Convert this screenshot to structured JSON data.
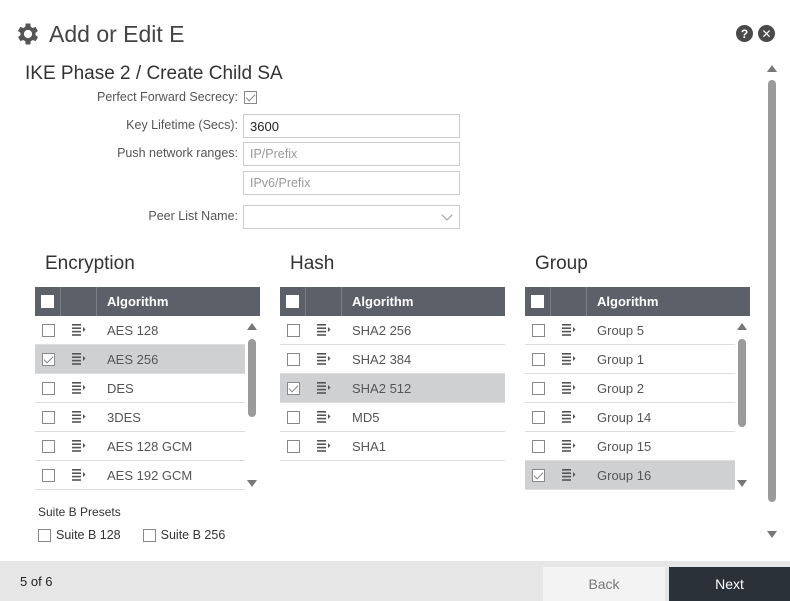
{
  "header": {
    "title": "Add or Edit E"
  },
  "section": {
    "title": "IKE Phase 2 / Create Child SA"
  },
  "form": {
    "pfs_label": "Perfect Forward Secrecy:",
    "pfs_checked": true,
    "lifetime_label": "Key Lifetime (Secs):",
    "lifetime_value": "3600",
    "push_label": "Push network ranges:",
    "ipv4_placeholder": "IP/Prefix",
    "ipv6_placeholder": "IPv6/Prefix",
    "peer_label": "Peer List Name:",
    "peer_value": ""
  },
  "tables": {
    "column_header": "Algorithm",
    "encryption": {
      "title": "Encryption",
      "rows": [
        {
          "label": "AES 128",
          "checked": false
        },
        {
          "label": "AES 256",
          "checked": true
        },
        {
          "label": "DES",
          "checked": false
        },
        {
          "label": "3DES",
          "checked": false
        },
        {
          "label": "AES 128 GCM",
          "checked": false
        },
        {
          "label": "AES 192 GCM",
          "checked": false
        }
      ]
    },
    "hash": {
      "title": "Hash",
      "rows": [
        {
          "label": "SHA2 256",
          "checked": false
        },
        {
          "label": "SHA2 384",
          "checked": false
        },
        {
          "label": "SHA2 512",
          "checked": true
        },
        {
          "label": "MD5",
          "checked": false
        },
        {
          "label": "SHA1",
          "checked": false
        }
      ]
    },
    "group": {
      "title": "Group",
      "rows": [
        {
          "label": "Group 5",
          "checked": false
        },
        {
          "label": "Group 1",
          "checked": false
        },
        {
          "label": "Group 2",
          "checked": false
        },
        {
          "label": "Group 14",
          "checked": false
        },
        {
          "label": "Group 15",
          "checked": false
        },
        {
          "label": "Group 16",
          "checked": true
        }
      ]
    }
  },
  "presets": {
    "title": "Suite B Presets",
    "opt128": "Suite B 128",
    "opt256": "Suite B 256"
  },
  "footer": {
    "step": "5 of 6",
    "back_label": "Back",
    "next_label": "Next"
  },
  "icons": {
    "settings": "gear-icon",
    "help": "help-icon",
    "close": "close-icon",
    "row": "list-menu-icon"
  },
  "colors": {
    "table_header": "#5b6069",
    "selected_row": "#cfd0d2",
    "next_button": "#2a3139"
  }
}
